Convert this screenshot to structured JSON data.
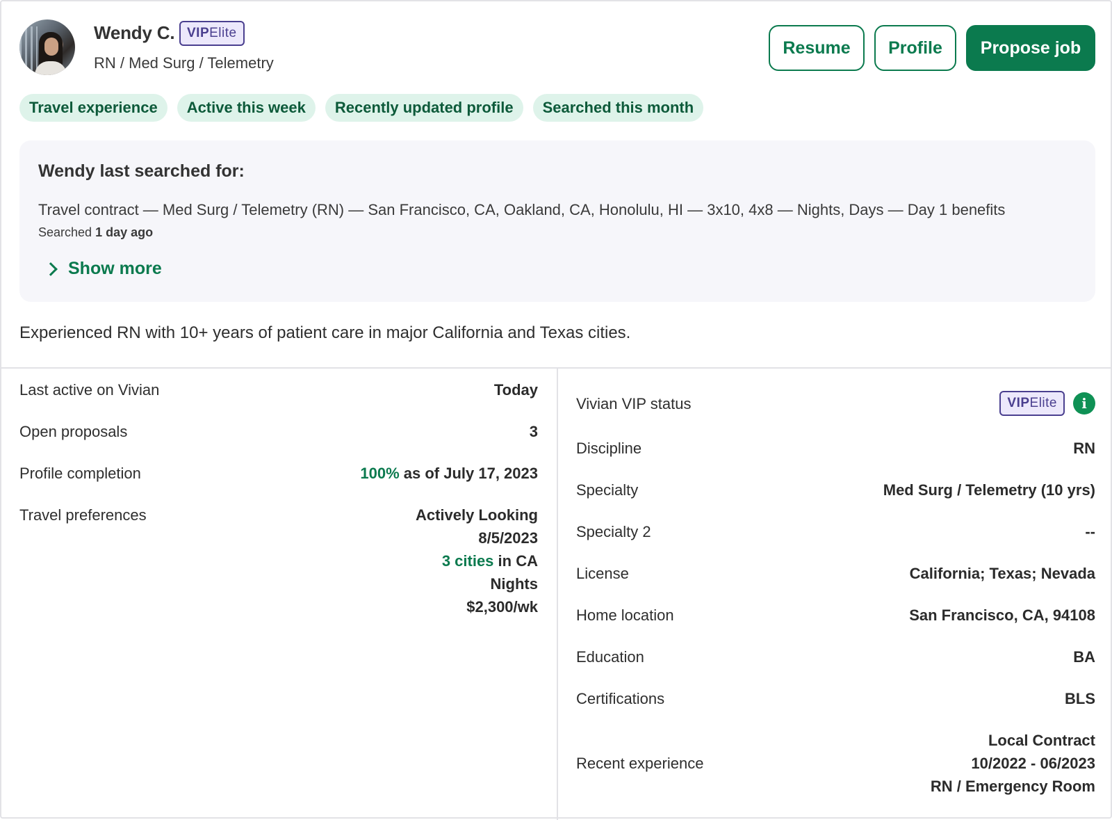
{
  "candidate": {
    "name": "Wendy C.",
    "vip_prefix": "VIP",
    "vip_tier": "Elite",
    "subtitle": "RN / Med Surg / Telemetry"
  },
  "actions": {
    "resume": "Resume",
    "profile": "Profile",
    "propose": "Propose job"
  },
  "tags": [
    "Travel experience",
    "Active this week",
    "Recently updated profile",
    "Searched this month"
  ],
  "last_search": {
    "title": "Wendy last searched for:",
    "query": "Travel contract — Med Surg / Telemetry (RN) — San Francisco, CA, Oakland, CA, Honolulu, HI — 3x10, 4x8 — Nights, Days — Day 1 benefits",
    "searched_prefix": "Searched",
    "searched_when": "1 day ago",
    "show_more": "Show more"
  },
  "summary": "Experienced RN with 10+ years of patient care in major California and Texas cities.",
  "left_details": {
    "last_active_label": "Last active on Vivian",
    "last_active_value": "Today",
    "open_proposals_label": "Open proposals",
    "open_proposals_value": "3",
    "profile_completion_label": "Profile completion",
    "profile_completion_percent": "100%",
    "profile_completion_date": "as of July 17, 2023",
    "travel_pref_label": "Travel preferences",
    "travel_pref_status": "Actively Looking",
    "travel_pref_date": "8/5/2023",
    "travel_pref_cities": "3 cities",
    "travel_pref_cities_suffix": "in CA",
    "travel_pref_shift": "Nights",
    "travel_pref_pay": "$2,300/wk"
  },
  "right_details": {
    "vip_label": "Vivian VIP status",
    "vip_prefix": "VIP",
    "vip_tier": "Elite",
    "info_glyph": "i",
    "discipline_label": "Discipline",
    "discipline_value": "RN",
    "specialty_label": "Specialty",
    "specialty_value": "Med Surg / Telemetry (10 yrs)",
    "specialty2_label": "Specialty 2",
    "specialty2_value": "--",
    "license_label": "License",
    "license_value": "California; Texas; Nevada",
    "home_label": "Home location",
    "home_value": "San Francisco, CA, 94108",
    "education_label": "Education",
    "education_value": "BA",
    "certs_label": "Certifications",
    "certs_value": "BLS",
    "recent_label": "Recent experience",
    "recent_type": "Local Contract",
    "recent_dates": "10/2022 - 06/2023",
    "recent_role": "RN / Emergency Room"
  },
  "colors": {
    "brand_green": "#0b7a4e",
    "tag_bg": "#def3ea",
    "vip_border": "#4a3f8f",
    "vip_bg": "#ece8fb",
    "panel_bg": "#f6f6fa"
  }
}
